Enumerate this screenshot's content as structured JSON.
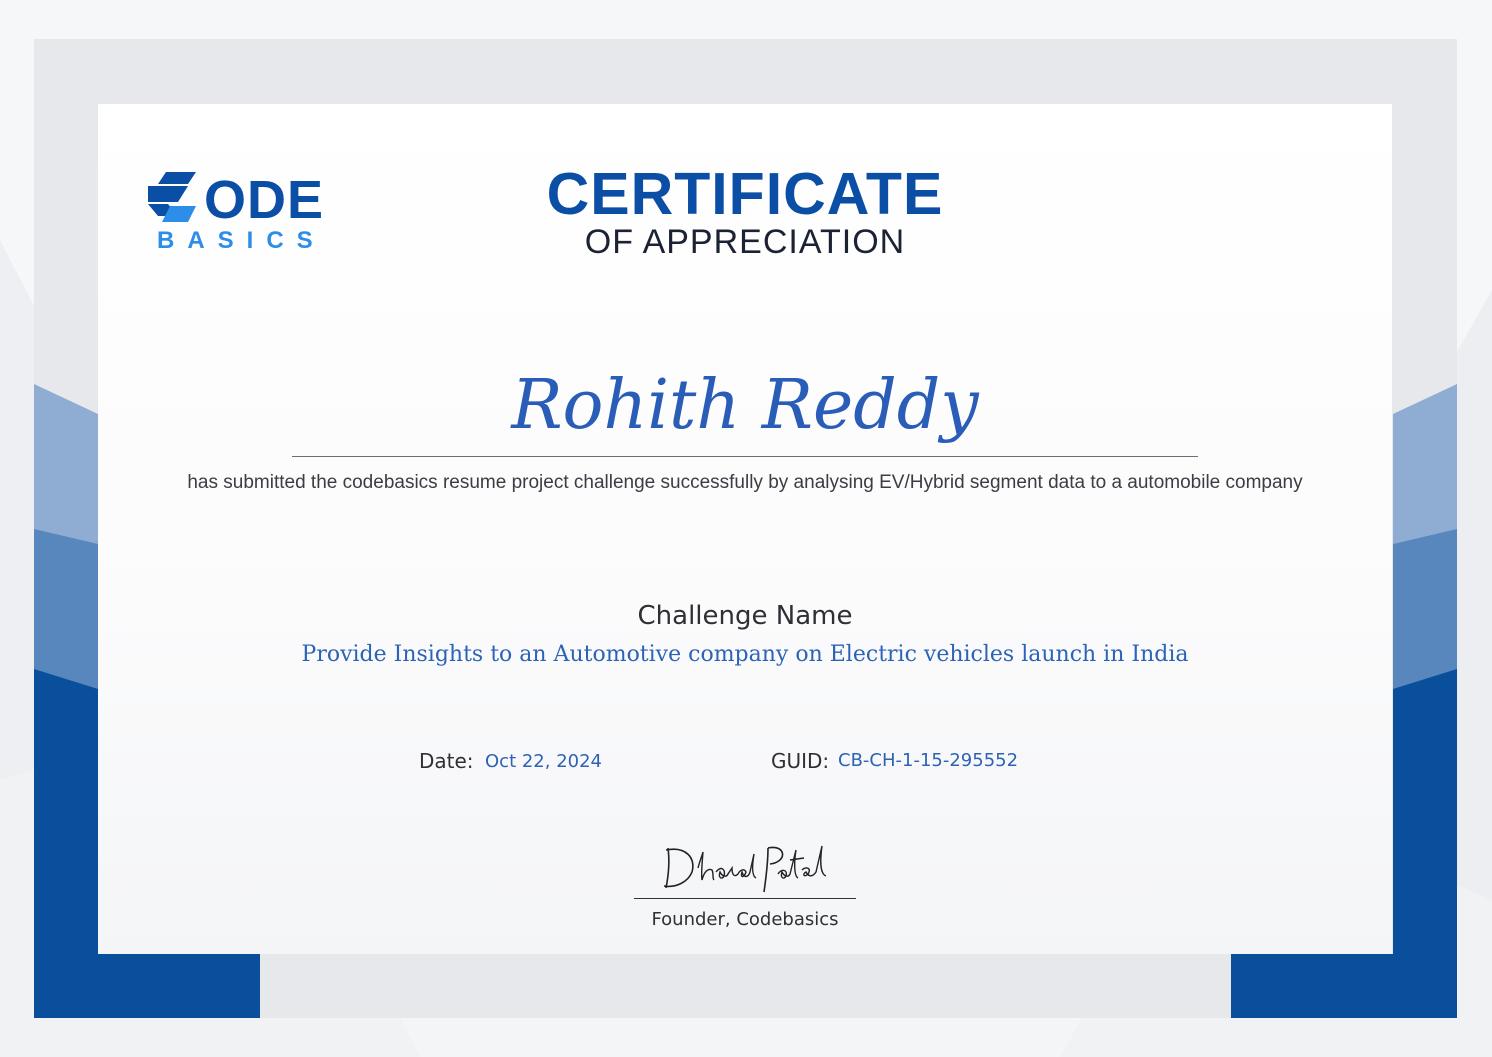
{
  "colors": {
    "brand_blue": "#0a4ea5",
    "accent_blue": "#2c63b4",
    "light_blue": "#2c8ee8",
    "frame_gray": "#e6e8ec"
  },
  "logo": {
    "word": "ODE",
    "sub": "BASICS"
  },
  "certificate": {
    "title": "CERTIFICATE",
    "subtitle": "OF APPRECIATION",
    "recipient": "Rohith Reddy",
    "statement": "has submitted the codebasics resume project challenge successfully by analysing EV/Hybrid segment data to a automobile company",
    "challenge_label": "Challenge Name",
    "challenge_name": "Provide Insights to an Automotive company on Electric vehicles launch in India",
    "date_label": "Date:",
    "date_value": "Oct 22, 2024",
    "guid_label": "GUID:",
    "guid_value": "CB-CH-1-15-295552",
    "signature": "Dhaval Patel",
    "signer_title": "Founder, Codebasics"
  }
}
